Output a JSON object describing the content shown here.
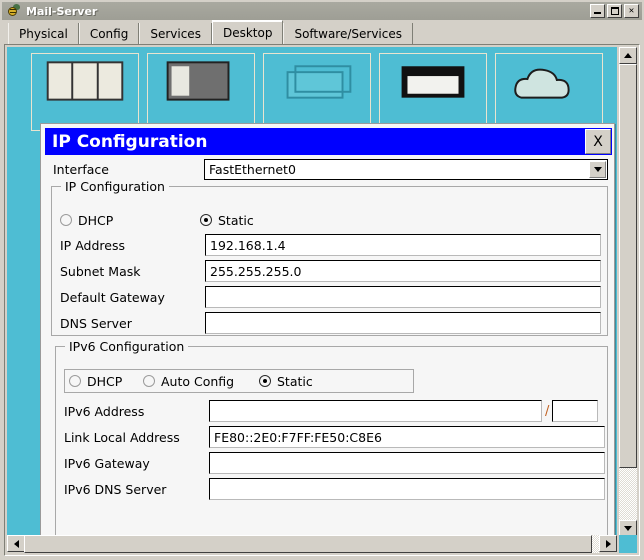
{
  "window": {
    "title": "Mail-Server",
    "icon": "bee-icon",
    "controls": {
      "minimize": "_",
      "maximize": "□",
      "close": "✕"
    }
  },
  "tabs": [
    {
      "label": "Physical",
      "active": false
    },
    {
      "label": "Config",
      "active": false
    },
    {
      "label": "Services",
      "active": false
    },
    {
      "label": "Desktop",
      "active": true
    },
    {
      "label": "Software/Services",
      "active": false
    }
  ],
  "desktop": {
    "background_color": "#4ebdd3",
    "tiles": [
      {
        "icon": "ip-configuration-icon"
      },
      {
        "icon": "dial-up-icon"
      },
      {
        "icon": "terminal-icon"
      },
      {
        "icon": "command-prompt-icon"
      },
      {
        "icon": "web-browser-icon"
      }
    ]
  },
  "dialog": {
    "title": "IP Configuration",
    "close_label": "X",
    "title_bar_color": "#0000ff",
    "interface": {
      "label": "Interface",
      "value": "FastEthernet0",
      "placeholder": ""
    },
    "ipv4": {
      "group_title": "IP Configuration",
      "modes": [
        {
          "label": "DHCP",
          "checked": false
        },
        {
          "label": "Static",
          "checked": true
        }
      ],
      "fields": [
        {
          "label": "IP Address",
          "value": "192.168.1.4",
          "placeholder": ""
        },
        {
          "label": "Subnet Mask",
          "value": "255.255.255.0",
          "placeholder": ""
        },
        {
          "label": "Default Gateway",
          "value": "",
          "placeholder": ""
        },
        {
          "label": "DNS Server",
          "value": "",
          "placeholder": ""
        }
      ]
    },
    "ipv6": {
      "group_title": "IPv6 Configuration",
      "modes": [
        {
          "label": "DHCP",
          "checked": false
        },
        {
          "label": "Auto Config",
          "checked": false
        },
        {
          "label": "Static",
          "checked": true
        }
      ],
      "address_row": {
        "label": "IPv6 Address",
        "value": "",
        "separator": "/",
        "prefix_value": ""
      },
      "fields": [
        {
          "label": "Link Local Address",
          "value": "FE80::2E0:F7FF:FE50:C8E6",
          "placeholder": ""
        },
        {
          "label": "IPv6 Gateway",
          "value": "",
          "placeholder": ""
        },
        {
          "label": "IPv6 DNS Server",
          "value": "",
          "placeholder": ""
        }
      ]
    }
  },
  "scrollbars": {
    "vertical": {
      "up_icon": "arrow-up-icon",
      "down_icon": "arrow-down-icon"
    },
    "horizontal": {
      "left_icon": "arrow-left-icon",
      "right_icon": "arrow-right-icon"
    }
  }
}
